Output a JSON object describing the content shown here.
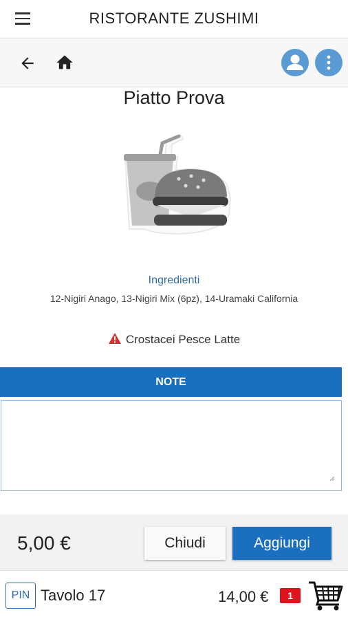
{
  "app": {
    "title": "RISTORANTE ZUSHIMI"
  },
  "toolbar": {
    "icons": [
      "menu-icon",
      "arrow-left-icon",
      "home-icon",
      "user-icon",
      "more-vertical-icon"
    ],
    "accent_color": "#5b9bd5"
  },
  "dish": {
    "name": "Piatto Prova",
    "image_icon": "burger-drink-icon",
    "ingredients_label": "Ingredienti",
    "ingredients": "12-Nigiri Anago, 13-Nigiri Mix (6pz), 14-Uramaki California",
    "allergens": "Crostacei Pesce Latte",
    "allergen_icon": "warning-icon",
    "warning_color": "#d32f2f"
  },
  "note": {
    "label": "NOTE",
    "value": "",
    "bar_color": "#1a6fbf"
  },
  "actions": {
    "price": "5,00 €",
    "close_label": "Chiudi",
    "add_label": "Aggiungi",
    "primary_color": "#1a6fbf"
  },
  "footer": {
    "pin_label": "PIN",
    "table": "Tavolo 17",
    "total": "14,00 €",
    "cart_count": "1",
    "badge_color": "#e0141e",
    "cart_icon": "shopping-cart-icon"
  }
}
